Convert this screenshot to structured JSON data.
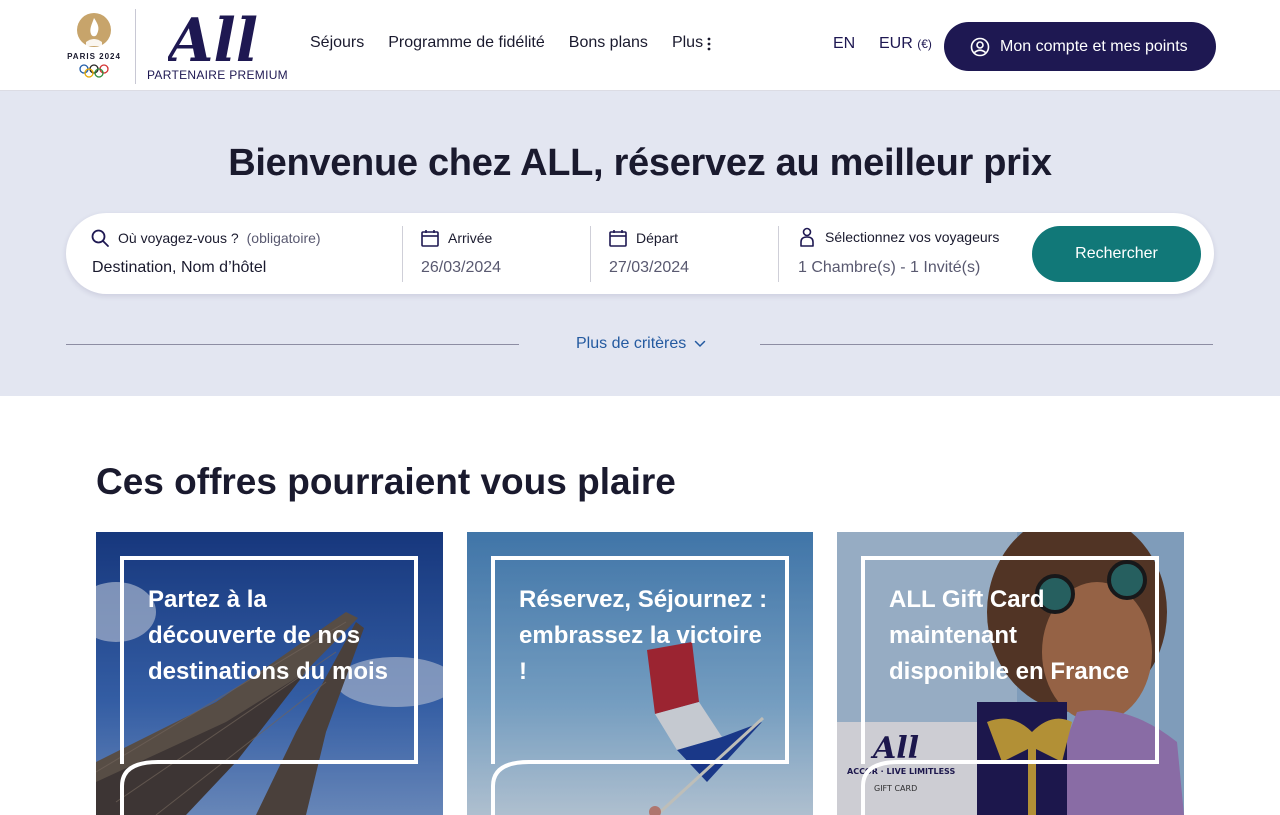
{
  "header": {
    "paris_logo_text": "PARIS 2024",
    "brand_logo_text": "All",
    "partner_text": "PARTENAIRE PREMIUM",
    "nav": [
      "Séjours",
      "Programme de fidélité",
      "Bons plans",
      "Plus"
    ],
    "lang": "EN",
    "currency": "EUR",
    "currency_symbol": "(€)",
    "account_button": "Mon compte et mes points"
  },
  "hero": {
    "title": "Bienvenue chez ALL, réservez au meilleur prix",
    "search": {
      "destination_label": "Où voyagez-vous ?",
      "destination_required": "(obligatoire)",
      "destination_placeholder": "Destination, Nom d’hôtel",
      "arrival_label": "Arrivée",
      "arrival_value": "26/03/2024",
      "departure_label": "Départ",
      "departure_value": "27/03/2024",
      "travelers_label": "Sélectionnez vos voyageurs",
      "travelers_value": "1 Chambre(s) - 1 Invité(s)",
      "search_button": "Rechercher"
    },
    "more_criteria": "Plus de critères"
  },
  "offers": {
    "title": "Ces offres pourraient vous plaire",
    "cards": [
      {
        "text": "Partez à la découverte de nos destinations du mois"
      },
      {
        "text": "Réservez, Séjournez : embrassez la victoire !"
      },
      {
        "text": "ALL Gift Card maintenant disponible en France",
        "giftcard_brand": "All",
        "giftcard_tagline": "ACCOR · LIVE LIMITLESS",
        "giftcard_label": "GIFT CARD"
      }
    ]
  },
  "colors": {
    "brand_navy": "#1e1852",
    "search_teal": "#117878",
    "hero_bg": "#e3e6f1",
    "link_blue": "#245aa0"
  },
  "icons": [
    "olympic-flame-icon",
    "olympic-rings-icon",
    "kebab-menu-icon",
    "user-circle-icon",
    "search-icon",
    "calendar-icon",
    "person-icon",
    "chevron-down-icon"
  ]
}
